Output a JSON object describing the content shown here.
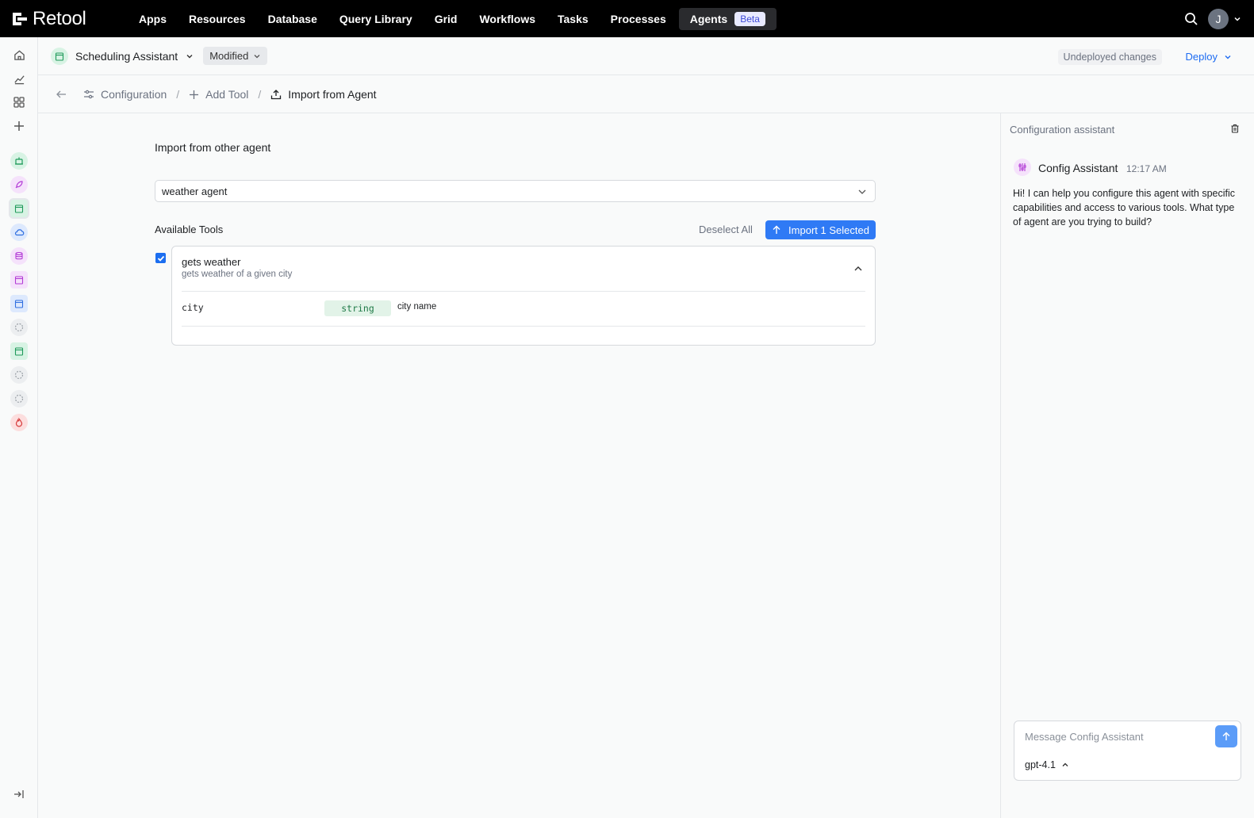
{
  "brand": "Retool",
  "nav": {
    "items": [
      {
        "label": "Apps"
      },
      {
        "label": "Resources"
      },
      {
        "label": "Database"
      },
      {
        "label": "Query Library"
      },
      {
        "label": "Grid"
      },
      {
        "label": "Workflows"
      },
      {
        "label": "Tasks"
      },
      {
        "label": "Processes"
      }
    ],
    "active": {
      "label": "Agents",
      "badge": "Beta"
    },
    "avatar_initial": "J"
  },
  "app": {
    "name": "Scheduling Assistant",
    "status": "Modified",
    "undeployed": "Undeployed changes",
    "deploy": "Deploy"
  },
  "breadcrumb": {
    "items": [
      "Configuration",
      "Add Tool",
      "Import from Agent"
    ]
  },
  "import": {
    "title": "Import from other agent",
    "selected_agent": "weather agent",
    "available_label": "Available Tools",
    "deselect_label": "Deselect All",
    "import_label": "Import 1 Selected",
    "tool": {
      "name": "gets weather",
      "description": "gets weather of a given city",
      "checked": true,
      "params": [
        {
          "name": "city",
          "type": "string",
          "description": "city name"
        }
      ]
    }
  },
  "assistant": {
    "panel_title": "Configuration assistant",
    "sender": "Config Assistant",
    "time": "12:17 AM",
    "message": "Hi! I can help you configure this agent with specific capabilities and access to various tools. What type of agent are you trying to build?",
    "placeholder": "Message Config Assistant",
    "model": "gpt-4.1"
  },
  "colors": {
    "accent": "#2f7af5",
    "topbar": "#000000",
    "beta_badge_bg": "#e8eaff",
    "string_badge_bg": "#e2f3e8"
  }
}
